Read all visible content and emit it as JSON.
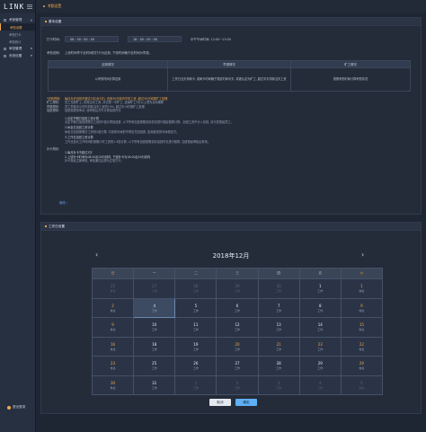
{
  "app": {
    "logo": "LINK"
  },
  "sidebar": {
    "groups": [
      {
        "label": "考勤管理",
        "subs": [
          {
            "label": "考勤设置",
            "active": true
          },
          {
            "label": "考勤打卡",
            "active": false
          },
          {
            "label": "考勤统计",
            "active": false
          }
        ]
      },
      {
        "label": "审批管理"
      },
      {
        "label": "系统设置"
      }
    ],
    "logout": "退出登录"
  },
  "topbar": {
    "title": "考勤设置"
  },
  "settings": {
    "header": "基本设置",
    "time_label": "打卡时间:",
    "start_time": "08 : 00 : 00 : 00",
    "end_time": "18 : 00 : 00 : 00",
    "note": "中午午休时间: 12:00~13:00",
    "rule_label": "考勤说明:",
    "rule_text": "上班时间早于此时间的打卡为迟到, 下班时间晚于此时间为早退。",
    "table": {
      "headers": [
        "迟到情况",
        "早退情况",
        "旷工情况"
      ],
      "cells": [
        "以考勤时间计算迟到",
        "工作日当天未刷卡, 或刷卡时间晚于规定时间半天, 将被认定为旷工, 超过半天扣除当天工资",
        "按照考勤时间计算考勤情况"
      ]
    },
    "lines": [
      {
        "label": "*迟到规则:",
        "text": "每月允许迟到不超过3次(含3次), 迟到30分钟内不扣工资, 超过30分钟按旷工处理",
        "hl": true
      },
      {
        "label": "旷工规则:",
        "text": "员工无故旷工, 扣除当天工资, 并记录一次旷工, 连续旷工3天以上视为自动离职"
      },
      {
        "label": "早退规则:",
        "text": "员工早退半小时内扣除当天工资的10%, 超过半小时按旷工处理"
      },
      {
        "label": "加班规则:",
        "text": "加班需提前申请, 经审批后方可计算加班时长"
      }
    ],
    "sub_rules": [
      {
        "title": "1.法定节假日加班工资计算",
        "text": "法定节假日加班按照日工资的3倍计算加班费, 以下所有加班按照实际情况进行相应核算计算。加班工资不计入绩效, 另行发放给员工。"
      },
      {
        "title": "2.休息日加班工资计算",
        "text": "休息日加班按照日工资的2倍计算, 可安排补休的不再支付加班费, 如未能安排补休需支付。"
      },
      {
        "title": "3.工作日加班工资计算",
        "text": "工作日延长工作时间的按照小时工资的1.5倍计算, 以下所有加班按照实际加班时长进行核算, 加班需经审批后有效。"
      }
    ],
    "makeup_label": "补卡规则:",
    "makeup": [
      {
        "title": "1.每月补卡不超过3次",
        "text": ""
      },
      {
        "title": "2.上班补卡时间为08:00后30分钟内, 下班补卡为18:00后30分钟内",
        "text": "补卡需经主管审批, 审批通过后视为正常打卡。"
      }
    ],
    "link": "修改 ›"
  },
  "calendar": {
    "header": "工作日设置",
    "title": "2018年12月",
    "prev": "‹",
    "next": "›",
    "weekdays": [
      "日",
      "一",
      "二",
      "三",
      "四",
      "五",
      "六"
    ],
    "weeks": [
      [
        {
          "d": "25",
          "s": "休息",
          "o": true
        },
        {
          "d": "27",
          "s": "工作",
          "o": true
        },
        {
          "d": "28",
          "s": "工作",
          "o": true
        },
        {
          "d": "29",
          "s": "工作",
          "o": true
        },
        {
          "d": "30",
          "s": "工作",
          "o": true
        },
        {
          "d": "1",
          "s": "工作"
        },
        {
          "d": "1",
          "s": "休息"
        }
      ],
      [
        {
          "d": "2",
          "s": "休息"
        },
        {
          "d": "4",
          "s": "工作",
          "sel": true
        },
        {
          "d": "5",
          "s": "工作"
        },
        {
          "d": "6",
          "s": "工作"
        },
        {
          "d": "7",
          "s": "工作"
        },
        {
          "d": "8",
          "s": "工作"
        },
        {
          "d": "9",
          "s": "休息"
        }
      ],
      [
        {
          "d": "9",
          "s": "休息"
        },
        {
          "d": "10",
          "s": "工作"
        },
        {
          "d": "11",
          "s": "工作"
        },
        {
          "d": "12",
          "s": "工作"
        },
        {
          "d": "13",
          "s": "工作"
        },
        {
          "d": "14",
          "s": "工作"
        },
        {
          "d": "15",
          "s": "休息"
        }
      ],
      [
        {
          "d": "16",
          "s": "休息"
        },
        {
          "d": "18",
          "s": "工作"
        },
        {
          "d": "19",
          "s": "工作"
        },
        {
          "d": "20",
          "s": "工作",
          "w": true
        },
        {
          "d": "21",
          "s": "工作",
          "w": true
        },
        {
          "d": "23",
          "s": "工作",
          "w": true
        },
        {
          "d": "22",
          "s": "休息"
        }
      ],
      [
        {
          "d": "23",
          "s": "休息"
        },
        {
          "d": "25",
          "s": "工作"
        },
        {
          "d": "26",
          "s": "工作"
        },
        {
          "d": "27",
          "s": "工作"
        },
        {
          "d": "28",
          "s": "工作"
        },
        {
          "d": "29",
          "s": "工作"
        },
        {
          "d": "29",
          "s": "休息"
        }
      ],
      [
        {
          "d": "30",
          "s": "休息"
        },
        {
          "d": "31",
          "s": "工作"
        },
        {
          "d": "1",
          "s": "工作",
          "o": true
        },
        {
          "d": "2",
          "s": "工作",
          "o": true
        },
        {
          "d": "3",
          "s": "工作",
          "o": true
        },
        {
          "d": "4",
          "s": "工作",
          "o": true
        },
        {
          "d": "5",
          "s": "休息",
          "o": true
        }
      ]
    ],
    "cancel": "取消",
    "ok": "确定"
  }
}
